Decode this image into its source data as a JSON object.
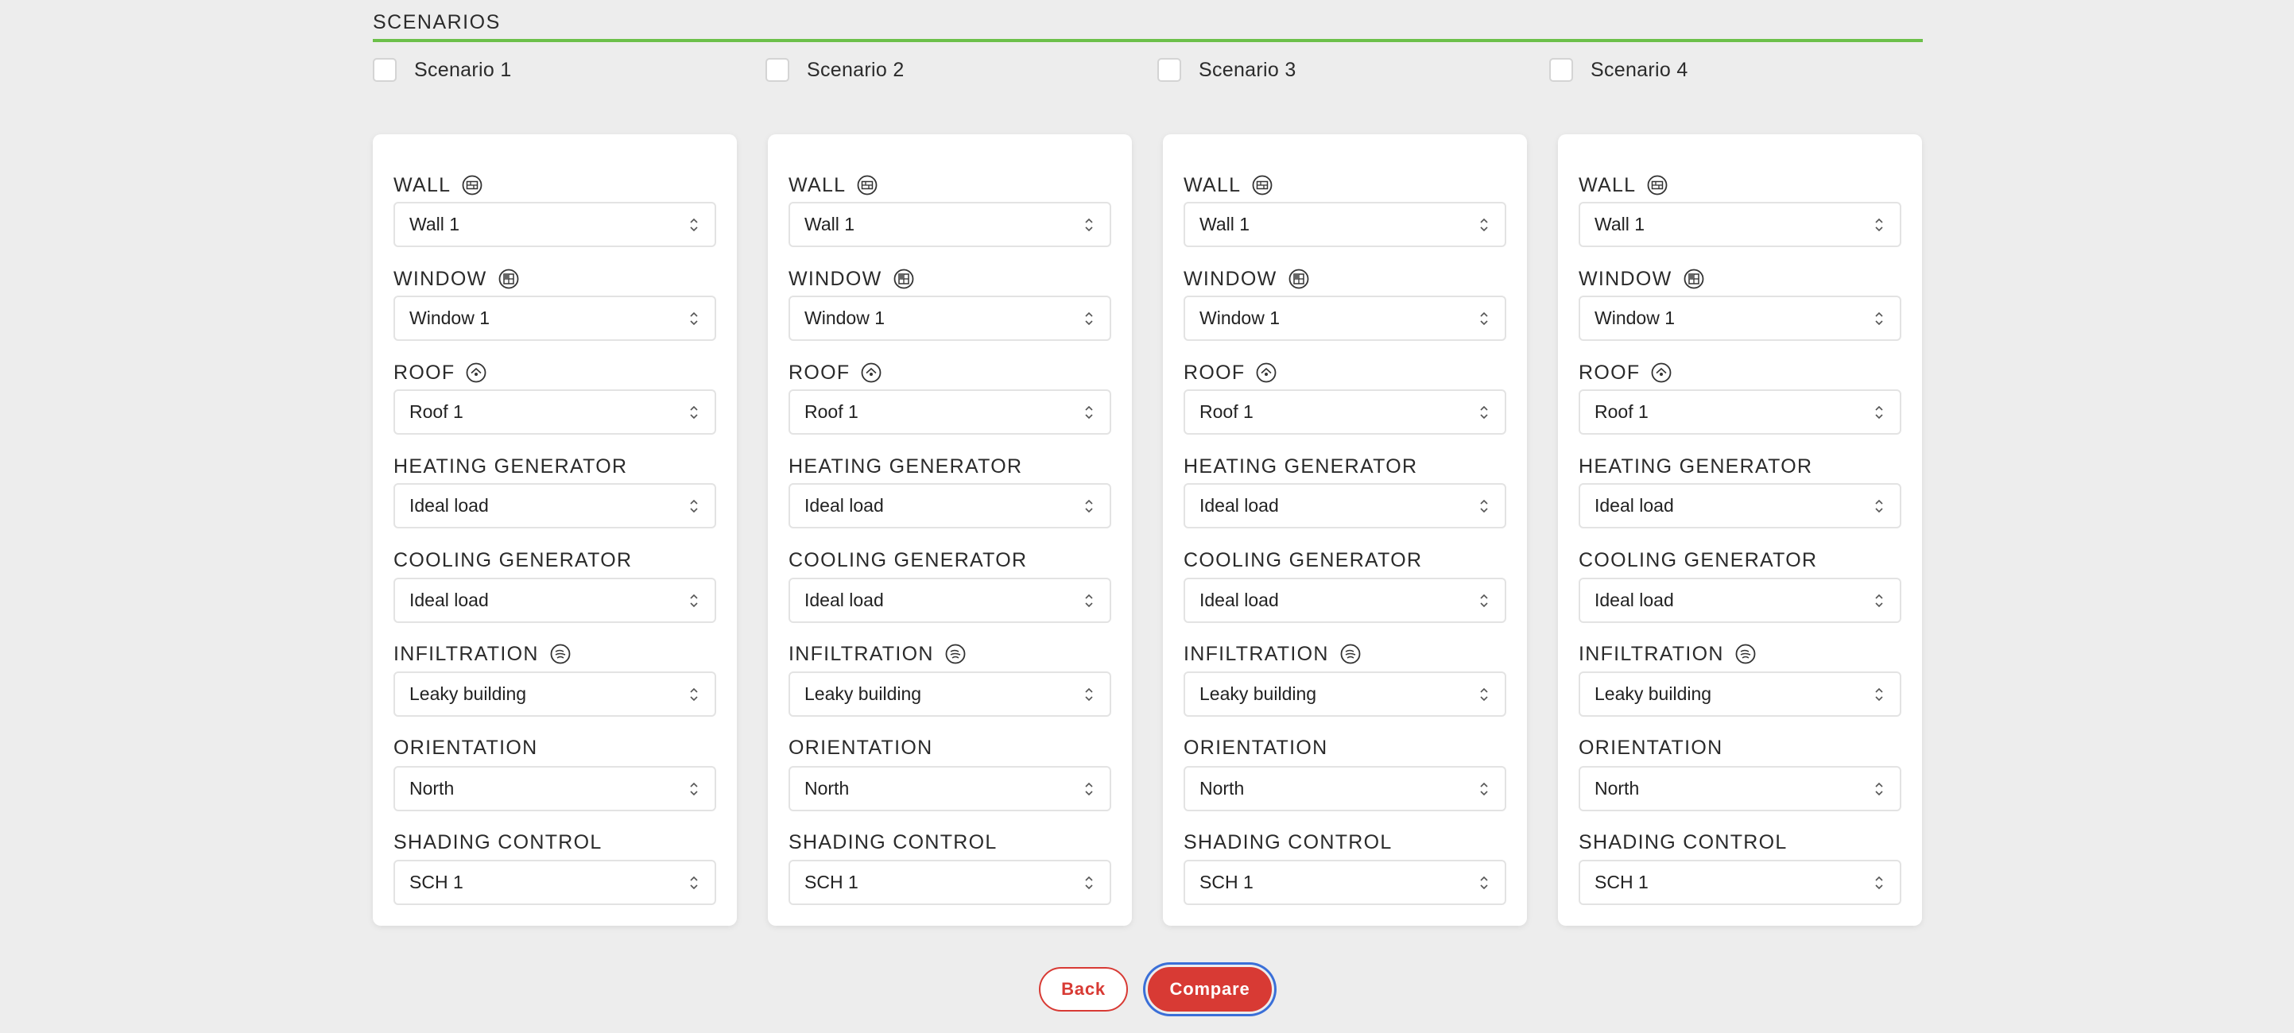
{
  "section": {
    "title": "SCENARIOS"
  },
  "scenarios": [
    {
      "label": "Scenario 1",
      "checked": false
    },
    {
      "label": "Scenario 2",
      "checked": false
    },
    {
      "label": "Scenario 3",
      "checked": false
    },
    {
      "label": "Scenario 4",
      "checked": false
    }
  ],
  "field_labels": {
    "wall": "WALL",
    "window": "WINDOW",
    "roof": "ROOF",
    "heating": "HEATING GENERATOR",
    "cooling": "COOLING GENERATOR",
    "infiltration": "INFILTRATION",
    "orientation": "ORIENTATION",
    "shading": "SHADING CONTROL"
  },
  "icons": {
    "wall": "wall-icon",
    "window": "window-icon",
    "roof": "roof-icon",
    "infiltration": "infiltration-icon"
  },
  "cards": [
    {
      "wall": "Wall 1",
      "window": "Window 1",
      "roof": "Roof 1",
      "heating": "Ideal load",
      "cooling": "Ideal load",
      "infiltration": "Leaky building",
      "orientation": "North",
      "shading": "SCH 1"
    },
    {
      "wall": "Wall 1",
      "window": "Window 1",
      "roof": "Roof 1",
      "heating": "Ideal load",
      "cooling": "Ideal load",
      "infiltration": "Leaky building",
      "orientation": "North",
      "shading": "SCH 1"
    },
    {
      "wall": "Wall 1",
      "window": "Window 1",
      "roof": "Roof 1",
      "heating": "Ideal load",
      "cooling": "Ideal load",
      "infiltration": "Leaky building",
      "orientation": "North",
      "shading": "SCH 1"
    },
    {
      "wall": "Wall 1",
      "window": "Window 1",
      "roof": "Roof 1",
      "heating": "Ideal load",
      "cooling": "Ideal load",
      "infiltration": "Leaky building",
      "orientation": "North",
      "shading": "SCH 1"
    }
  ],
  "actions": {
    "back_label": "Back",
    "compare_label": "Compare"
  },
  "colors": {
    "accent_green": "#6cc04a",
    "primary_red": "#d83a34",
    "focus_blue": "#3a6fd8",
    "background": "#ededed"
  }
}
